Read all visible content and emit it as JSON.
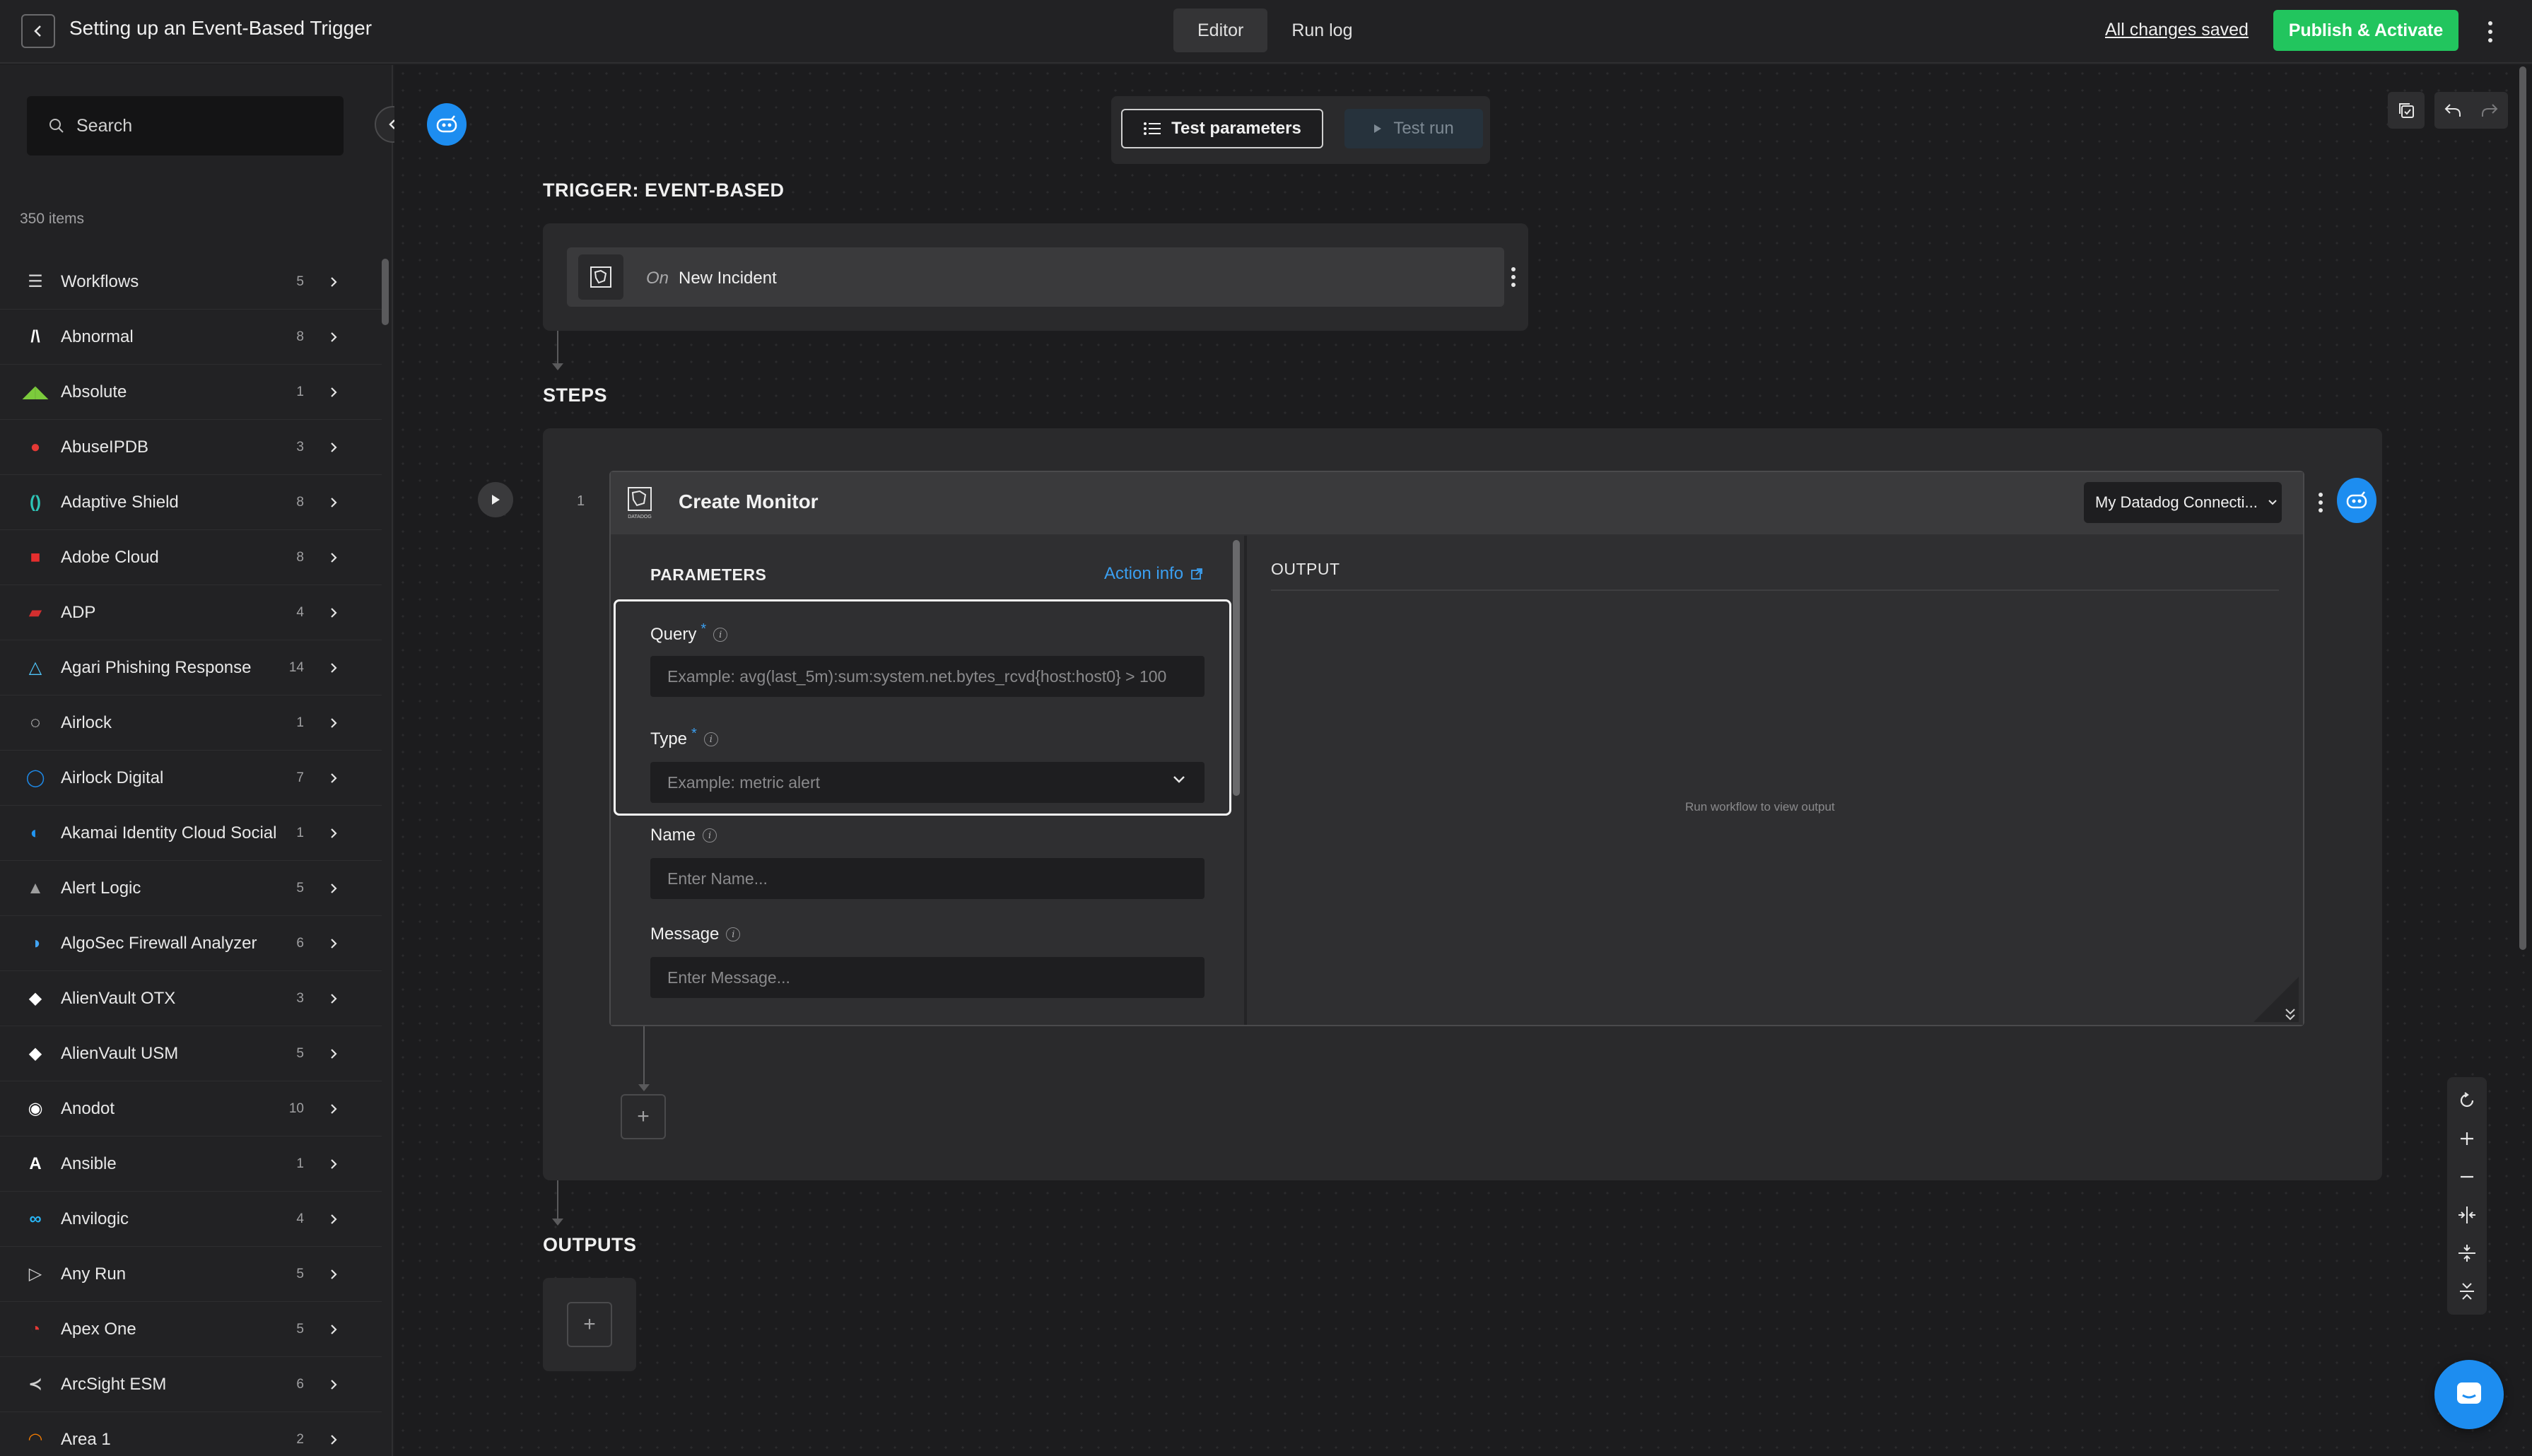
{
  "header": {
    "title": "Setting up an Event-Based Trigger",
    "tabs": [
      {
        "label": "Editor",
        "active": true
      },
      {
        "label": "Run log",
        "active": false
      }
    ],
    "saved_status": "All changes saved",
    "publish_label": "Publish & Activate",
    "publish_color": "#22c55e"
  },
  "sidebar": {
    "search_placeholder": "Search",
    "item_count": "350 items",
    "items": [
      {
        "label": "Workflows",
        "count": "5",
        "icon": "sliders-icon",
        "color": "#cfcfcf"
      },
      {
        "label": "Abnormal",
        "count": "8",
        "icon": "abnormal-logo-icon",
        "color": "#ffffff"
      },
      {
        "label": "Absolute",
        "count": "1",
        "icon": "absolute-logo-icon",
        "color": "#7ccb3c"
      },
      {
        "label": "AbuseIPDB",
        "count": "3",
        "icon": "abuseipdb-logo-icon",
        "color": "#e53935"
      },
      {
        "label": "Adaptive Shield",
        "count": "8",
        "icon": "adaptive-shield-logo-icon",
        "color": "#2ec4b6"
      },
      {
        "label": "Adobe Cloud",
        "count": "8",
        "icon": "adobe-logo-icon",
        "color": "#e62e2e"
      },
      {
        "label": "ADP",
        "count": "4",
        "icon": "adp-logo-icon",
        "color": "#d32f2f"
      },
      {
        "label": "Agari Phishing Response",
        "count": "14",
        "icon": "agari-logo-icon",
        "color": "#4fc3f7"
      },
      {
        "label": "Airlock",
        "count": "1",
        "icon": "airlock-logo-icon",
        "color": "#ffffff"
      },
      {
        "label": "Airlock Digital",
        "count": "7",
        "icon": "airlock-digital-logo-icon",
        "color": "#1e88e5"
      },
      {
        "label": "Akamai Identity Cloud Social",
        "count": "1",
        "icon": "akamai-logo-icon",
        "color": "#2196f3"
      },
      {
        "label": "Alert Logic",
        "count": "5",
        "icon": "alert-logic-logo-icon",
        "color": "#9e9e9e"
      },
      {
        "label": "AlgoSec Firewall Analyzer",
        "count": "6",
        "icon": "algosec-logo-icon",
        "color": "#42a5f5"
      },
      {
        "label": "AlienVault OTX",
        "count": "3",
        "icon": "alien-head-icon",
        "color": "#ffffff"
      },
      {
        "label": "AlienVault USM",
        "count": "5",
        "icon": "alien-head-icon",
        "color": "#ffffff"
      },
      {
        "label": "Anodot",
        "count": "10",
        "icon": "anodot-logo-icon",
        "color": "#ffffff"
      },
      {
        "label": "Ansible",
        "count": "1",
        "icon": "ansible-logo-icon",
        "color": "#ffffff"
      },
      {
        "label": "Anvilogic",
        "count": "4",
        "icon": "anvilogic-logo-icon",
        "color": "#29b6f6"
      },
      {
        "label": "Any Run",
        "count": "5",
        "icon": "any-run-logo-icon",
        "color": "#cfcfcf"
      },
      {
        "label": "Apex One",
        "count": "5",
        "icon": "apex-one-logo-icon",
        "color": "#e53935"
      },
      {
        "label": "ArcSight ESM",
        "count": "6",
        "icon": "arcsight-logo-icon",
        "color": "#cfcfcf"
      },
      {
        "label": "Area 1",
        "count": "2",
        "icon": "area1-logo-icon",
        "color": "#f57c00"
      }
    ]
  },
  "toolbar": {
    "test_params_label": "Test parameters",
    "test_run_label": "Test run"
  },
  "trigger": {
    "section_label": "TRIGGER: EVENT-BASED",
    "prefix": "On",
    "event": "New Incident"
  },
  "steps": {
    "section_label": "STEPS",
    "step": {
      "number": "1",
      "title": "Create Monitor",
      "connection": "My Datadog Connecti...",
      "icon_caption": "DATADOG",
      "params_label": "PARAMETERS",
      "action_info": "Action info",
      "fields": {
        "query": {
          "label": "Query",
          "required": "*",
          "placeholder": "Example: avg(last_5m):sum:system.net.bytes_rcvd{host:host0} > 100"
        },
        "type": {
          "label": "Type",
          "required": "*",
          "placeholder": "Example: metric alert"
        },
        "name": {
          "label": "Name",
          "placeholder": "Enter Name..."
        },
        "message": {
          "label": "Message",
          "placeholder": "Enter Message..."
        }
      },
      "output_label": "OUTPUT",
      "output_empty": "Run workflow to view output"
    },
    "add_label": "+"
  },
  "outputs": {
    "section_label": "OUTPUTS",
    "add_label": "+"
  },
  "colors": {
    "accent": "#1d8df0",
    "link": "#3b9ff0"
  }
}
